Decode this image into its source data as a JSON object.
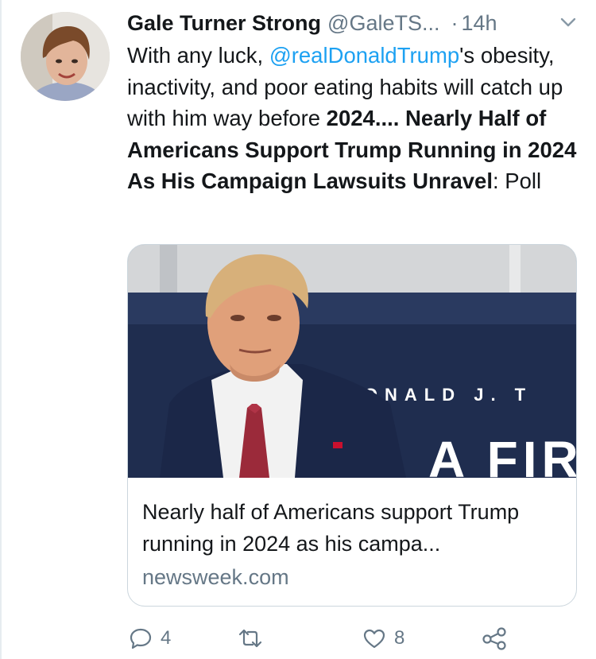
{
  "tweet": {
    "display_name": "Gale Turner Strong",
    "handle": "@GaleTS...",
    "separator": "·",
    "time": "14h",
    "text_1": "With any luck, ",
    "mention": "@realDonaldTrump",
    "text_2": "'s obesity, inactivity, and poor eating habits will catch up with him way before ",
    "bold_text": "2024....  Nearly Half of Americans Support Trump Running in 2024 As His Campaign Lawsuits Unravel",
    "text_3": ": Poll"
  },
  "card": {
    "image_text": "DONALD J. T",
    "image_text_2": "A FIR",
    "title": "Nearly half of Americans support Trump running in 2024 as his campa...",
    "domain": "newsweek.com"
  },
  "actions": {
    "reply_count": "4",
    "retweet_count": "",
    "like_count": "8"
  },
  "icons": {
    "reply": "reply-icon",
    "retweet": "retweet-icon",
    "like": "heart-icon",
    "share": "share-icon",
    "more": "chevron-down-icon"
  },
  "colors": {
    "link": "#1da1f2",
    "secondary": "#657786",
    "border": "#ccd6dd"
  }
}
